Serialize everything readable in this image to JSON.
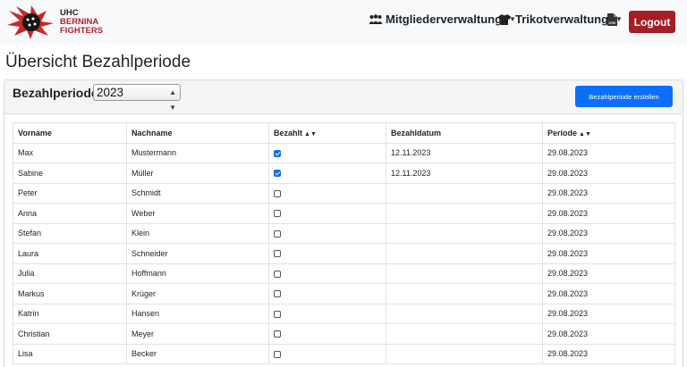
{
  "nav": {
    "logo": {
      "line1": "UHC",
      "line2": "BERNINA",
      "line3": "FIGHTERS"
    },
    "members_label": "Mitgliederverwaltung",
    "jerseys_label": "Trikotverwaltung",
    "csv_label": "CSV",
    "logout_label": "Logout"
  },
  "page": {
    "title": "Übersicht Bezahlperiode"
  },
  "filter": {
    "label": "Bezahlperiode:",
    "selected": "2023",
    "create_label": "Bezahlperiode erstellen"
  },
  "table": {
    "headers": [
      "Vorname",
      "Nachname",
      "Bezahlt",
      "Bezahldatum",
      "Periode"
    ],
    "rows": [
      {
        "first": "Max",
        "last": "Mustermann",
        "paid": true,
        "paid_date": "12.11.2023",
        "period": "29.08.2023"
      },
      {
        "first": "Sabine",
        "last": "Müller",
        "paid": true,
        "paid_date": "12.11.2023",
        "period": "29.08.2023"
      },
      {
        "first": "Peter",
        "last": "Schmidt",
        "paid": false,
        "paid_date": "",
        "period": "29.08.2023"
      },
      {
        "first": "Anna",
        "last": "Weber",
        "paid": false,
        "paid_date": "",
        "period": "29.08.2023"
      },
      {
        "first": "Stefan",
        "last": "Klein",
        "paid": false,
        "paid_date": "",
        "period": "29.08.2023"
      },
      {
        "first": "Laura",
        "last": "Schneider",
        "paid": false,
        "paid_date": "",
        "period": "29.08.2023"
      },
      {
        "first": "Julia",
        "last": "Hoffmann",
        "paid": false,
        "paid_date": "",
        "period": "29.08.2023"
      },
      {
        "first": "Markus",
        "last": "Krüger",
        "paid": false,
        "paid_date": "",
        "period": "29.08.2023"
      },
      {
        "first": "Katrin",
        "last": "Hansen",
        "paid": false,
        "paid_date": "",
        "period": "29.08.2023"
      },
      {
        "first": "Christian",
        "last": "Meyer",
        "paid": false,
        "paid_date": "",
        "period": "29.08.2023"
      },
      {
        "first": "Lisa",
        "last": "Becker",
        "paid": false,
        "paid_date": "",
        "period": "29.08.2023"
      }
    ]
  },
  "icons": {
    "members": "people-icon",
    "jerseys": "shirt-icon",
    "csv": "csv-file-icon",
    "sort": "sort-icon"
  },
  "colors": {
    "brand_red": "#a51e24",
    "primary_blue": "#0d6efd"
  }
}
